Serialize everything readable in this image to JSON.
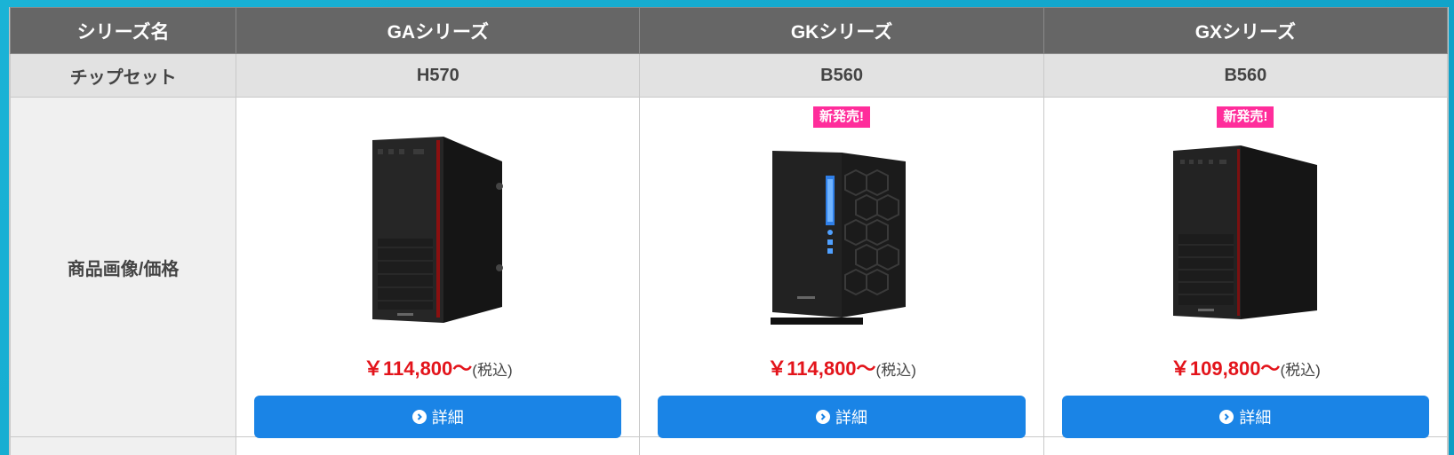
{
  "table": {
    "header_label": "シリーズ名",
    "series": [
      "GAシリーズ",
      "GKシリーズ",
      "GXシリーズ"
    ],
    "chipset_label": "チップセット",
    "chipsets": [
      "H570",
      "B560",
      "B560"
    ],
    "product_label": "商品画像/価格",
    "products": [
      {
        "badge": "",
        "price": "￥114,800～",
        "tax": "(税込)",
        "button": "詳細"
      },
      {
        "badge": "新発売!",
        "price": "￥114,800～",
        "tax": "(税込)",
        "button": "詳細"
      },
      {
        "badge": "新発売!",
        "price": "￥109,800～",
        "tax": "(税込)",
        "button": "詳細"
      }
    ]
  },
  "colors": {
    "price": "#e3141b",
    "button": "#1a84e6",
    "badge": "#ff2d9b",
    "header_bg": "#666666"
  }
}
